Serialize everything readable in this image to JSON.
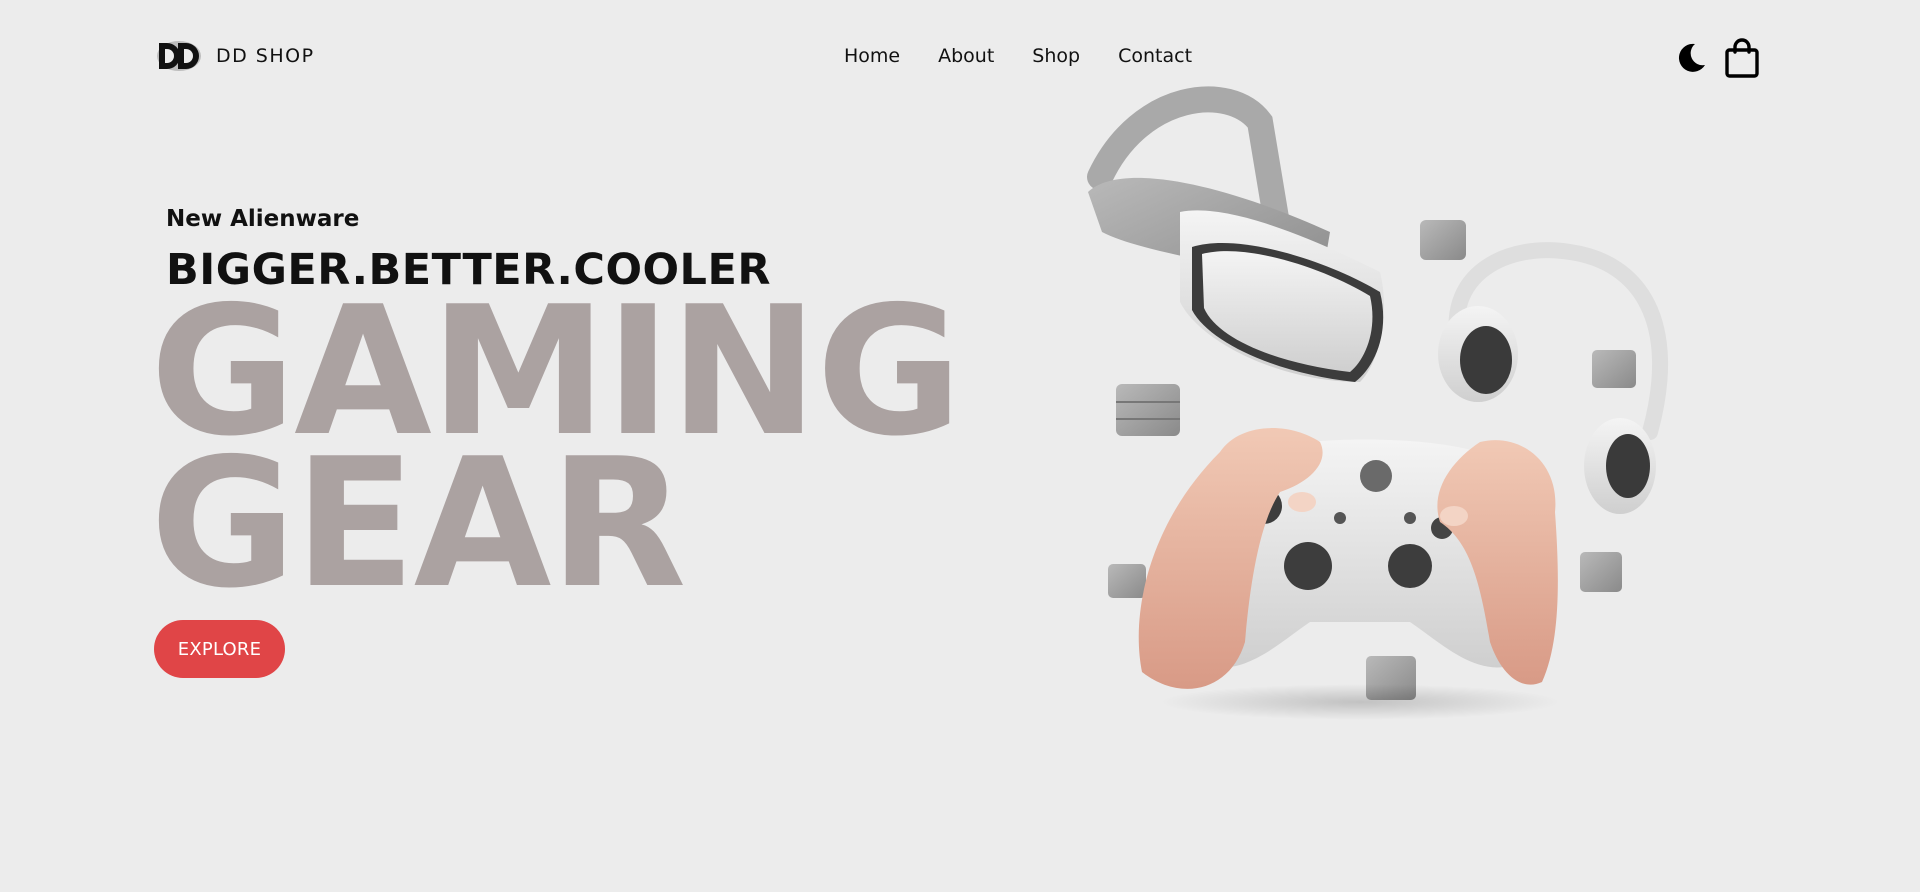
{
  "brand": {
    "name": "DD SHOP",
    "logo_icon": "dd-monogram-icon"
  },
  "nav": {
    "items": [
      {
        "label": "Home"
      },
      {
        "label": "About"
      },
      {
        "label": "Shop"
      },
      {
        "label": "Contact"
      }
    ]
  },
  "header_icons": {
    "theme": "moon-icon",
    "cart": "shopping-bag-icon"
  },
  "hero": {
    "kicker": "New Alienware",
    "tagline": "BIGGER.BETTER.COOLER",
    "headline_line1": "GAMING",
    "headline_line2": "GEAR",
    "cta_label": "EXPLORE",
    "image": "VR headset, headphones, game controller held by hands, floating cubes"
  },
  "colors": {
    "background": "#ececec",
    "headline": "#aba2a1",
    "cta": "#e04547",
    "text": "#111111"
  }
}
